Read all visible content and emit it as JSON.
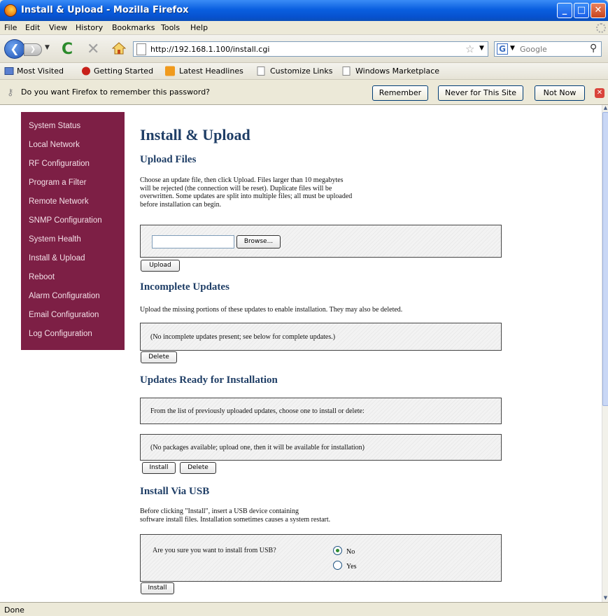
{
  "window": {
    "title": "Install & Upload - Mozilla Firefox",
    "app_icon": "firefox-logo-icon"
  },
  "menu": [
    "File",
    "Edit",
    "View",
    "History",
    "Bookmarks",
    "Tools",
    "Help"
  ],
  "nav": {
    "url": "http://192.168.1.100/install.cgi",
    "search_placeholder": "Google"
  },
  "bookmarks": [
    "Most Visited",
    "Getting Started",
    "Latest Headlines",
    "Customize Links",
    "Windows Marketplace"
  ],
  "notification": {
    "message": "Do you want Firefox to remember this password?",
    "remember": "Remember",
    "never": "Never for This Site",
    "not_now": "Not Now"
  },
  "sidebar": {
    "items": [
      "System Status",
      "Local Network",
      "RF Configuration",
      "Program a Filter",
      "Remote Network",
      "SNMP Configuration",
      "System Health",
      "Install & Upload",
      "Reboot",
      "Alarm Configuration",
      "Email Configuration",
      "Log Configuration"
    ],
    "color": "#7d1f45"
  },
  "page": {
    "title": "Install & Upload",
    "upload": {
      "heading": "Upload Files",
      "desc_lines": [
        "Choose an update file, then click Upload. Files larger than 10 megabytes",
        "will be rejected (the connection will be reset). Duplicate files will be",
        "overwritten. Some updates are split into multiple files; all must be uploaded",
        "before installation can begin."
      ],
      "browse": "Browse...",
      "upload_btn": "Upload"
    },
    "incomplete": {
      "heading": "Incomplete Updates",
      "desc": "Upload the missing portions of these updates to enable installation. They may also be deleted.",
      "box_text": "(No incomplete updates present; see below for complete updates.)",
      "delete_btn": "Delete"
    },
    "ready": {
      "heading": "Updates Ready for Installation",
      "choose_text": "From the list of previously uploaded updates, choose one to install or delete:",
      "none_text": "(No packages available; upload one, then it will be available for installation)",
      "install_btn": "Install",
      "delete_btn": "Delete"
    },
    "usb": {
      "heading": "Install Via USB",
      "desc_lines": [
        "Before clicking \"Install\", insert a USB device containing",
        "software install files. Installation sometimes causes a system restart."
      ],
      "question": "Are you sure you want to install from USB?",
      "option_no": "No",
      "option_yes": "Yes",
      "selected": "No",
      "install_btn": "Install"
    },
    "heading_color": "#1f3e66"
  },
  "status": "Done"
}
